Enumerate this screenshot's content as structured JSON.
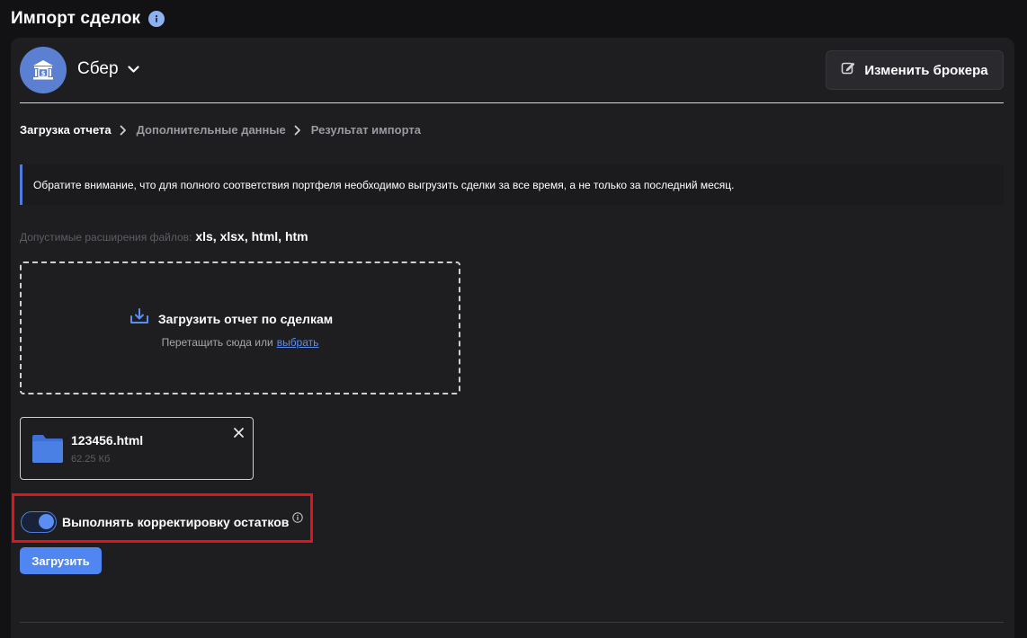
{
  "page": {
    "title": "Импорт сделок",
    "info_icon": "info-icon"
  },
  "broker": {
    "name": "Сбер",
    "avatar_icon": "bank-icon",
    "change_button_label": "Изменить брокера",
    "change_button_icon": "edit-icon"
  },
  "steps": [
    {
      "label": "Загрузка отчета",
      "active": true
    },
    {
      "label": "Дополнительные данные",
      "active": false
    },
    {
      "label": "Результат импорта",
      "active": false
    }
  ],
  "notice": {
    "text": "Обратите внимание, что для полного соответствия портфеля необходимо выгрузить сделки за все время, а не только за последний месяц."
  },
  "extensions": {
    "label": "Допустимые расширения файлов:",
    "value": "xls, xlsx, html, htm"
  },
  "dropzone": {
    "title": "Загрузить отчет по сделкам",
    "hint": "Перетащить сюда или",
    "link_label": "выбрать",
    "icon": "upload-icon"
  },
  "file": {
    "name": "123456.html",
    "size": "62.25 Кб",
    "icon": "folder-icon"
  },
  "adjust_toggle": {
    "label": "Выполнять корректировку остатков",
    "checked": true
  },
  "upload_button": {
    "label": "Загрузить"
  },
  "colors": {
    "accent": "#4f86f2",
    "highlight": "#e0151c",
    "background": "#121214",
    "card": "#1e1e21"
  }
}
